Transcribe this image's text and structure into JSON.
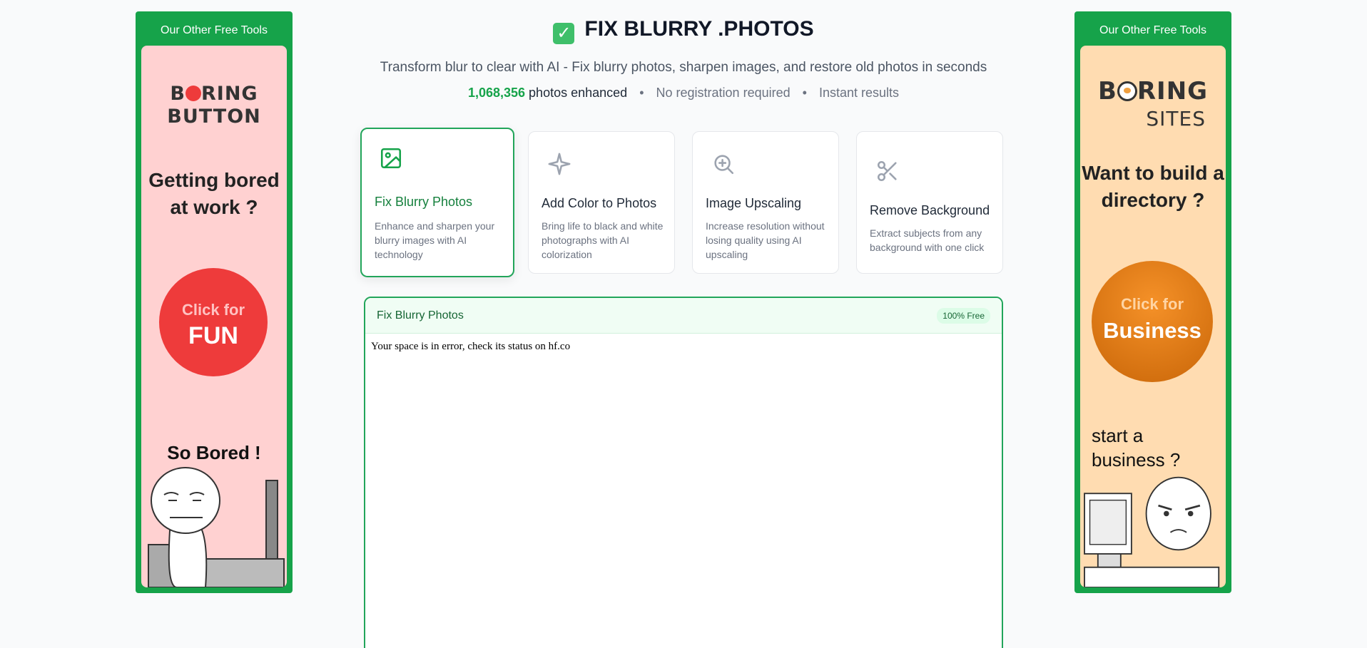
{
  "left_ad": {
    "header": "Our Other Free Tools",
    "logo_line1_a": "B",
    "logo_line1_b": "RING",
    "logo_line2": "BUTTON",
    "headline": "Getting bored at work ?",
    "button_top": "Click for",
    "button_main": "FUN",
    "tagline": "So Bored !"
  },
  "right_ad": {
    "header": "Our Other Free Tools",
    "logo_line1_a": "B",
    "logo_line1_b": "RING",
    "logo_line2": "SITES",
    "headline": "Want to build a directory ?",
    "button_top": "Click for",
    "button_main": "Business",
    "tagline": "start a business ?"
  },
  "header": {
    "title": "FIX BLURRY .PHOTOS",
    "subtitle": "Transform blur to clear with AI - Fix blurry photos, sharpen images, and restore old photos in seconds",
    "count": "1,068,356",
    "count_label": "photos enhanced",
    "no_registration": "No registration required",
    "instant": "Instant results",
    "separator": "•"
  },
  "tools": [
    {
      "name": "Fix Blurry Photos",
      "description": "Enhance and sharpen your blurry images with AI technology",
      "icon": "image-icon"
    },
    {
      "name": "Add Color to Photos",
      "description": "Bring life to black and white photographs with AI colorization",
      "icon": "sparkle-icon"
    },
    {
      "name": "Image Upscaling",
      "description": "Increase resolution without losing quality using AI upscaling",
      "icon": "zoom-in-icon"
    },
    {
      "name": "Remove Background",
      "description": "Extract subjects from any background with one click",
      "icon": "scissors-icon"
    }
  ],
  "panel": {
    "title": "Fix Blurry Photos",
    "badge": "100% Free",
    "message": "Your space is in error, check its status on hf.co"
  },
  "colors": {
    "accent": "#16a34a",
    "left_ad_bg": "#ffd1d1",
    "right_ad_bg": "#ffdcb1"
  }
}
